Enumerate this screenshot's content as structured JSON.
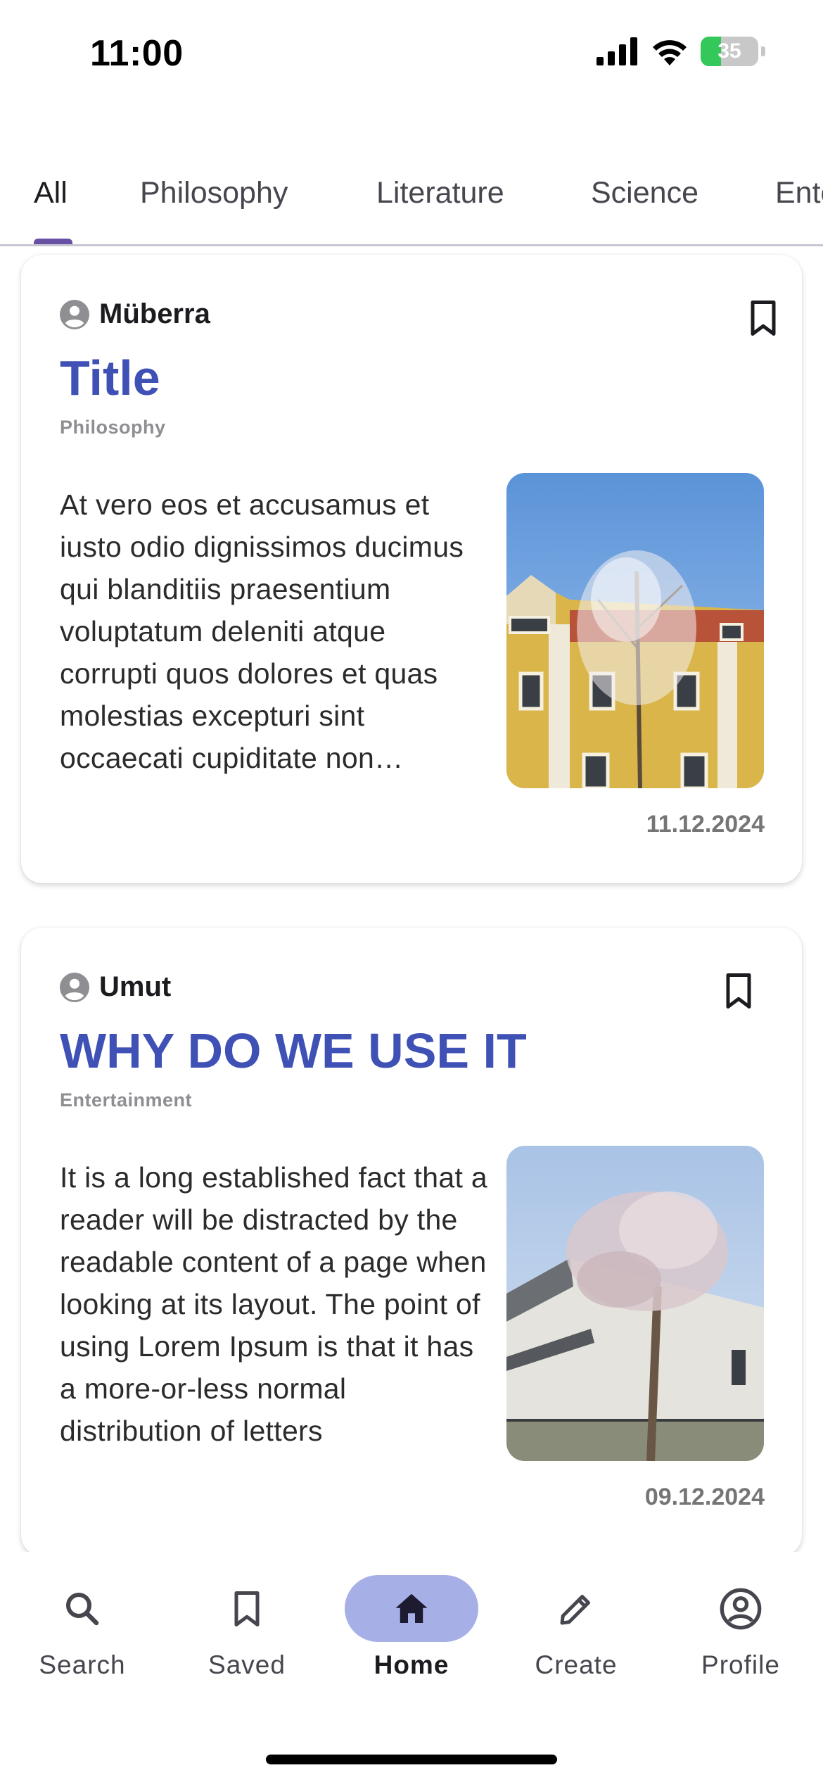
{
  "status_bar": {
    "time": "11:00",
    "battery": "35"
  },
  "tabs": [
    {
      "label": "All",
      "active": true
    },
    {
      "label": "Philosophy"
    },
    {
      "label": "Literature"
    },
    {
      "label": "Science"
    },
    {
      "label": "Entertainment"
    }
  ],
  "posts": [
    {
      "author": "Müberra",
      "title": "Title",
      "category": "Philosophy",
      "body": "At vero eos et accusamus et iusto odio dignissimos ducimus qui blanditiis praesentium voluptatum deleniti atque corrupti quos dolores et quas molestias excepturi sint occaecati cupiditate non provident",
      "date": "11.12.2024",
      "image": "yellow-building-blossom-tree"
    },
    {
      "author": "Umut",
      "title": "WHY DO WE USE IT",
      "category": "Entertainment",
      "body": "It is a long established fact that a reader will be distracted by the readable content of a page when looking at its layout. The point of using Lorem Ipsum is that it has a more-or-less normal distribution of letters",
      "date": "09.12.2024",
      "image": "modern-building-blossom-tree"
    }
  ],
  "bottom_nav": [
    {
      "label": "Search",
      "icon": "search-icon"
    },
    {
      "label": "Saved",
      "icon": "bookmark-icon"
    },
    {
      "label": "Home",
      "icon": "home-icon",
      "active": true
    },
    {
      "label": "Create",
      "icon": "pencil-icon"
    },
    {
      "label": "Profile",
      "icon": "account-circle-icon"
    }
  ],
  "colors": {
    "accent": "#3f51b5",
    "tab_indicator": "#6750a4",
    "nav_active_pill": "#a7b0e6",
    "battery": "#34c759"
  }
}
